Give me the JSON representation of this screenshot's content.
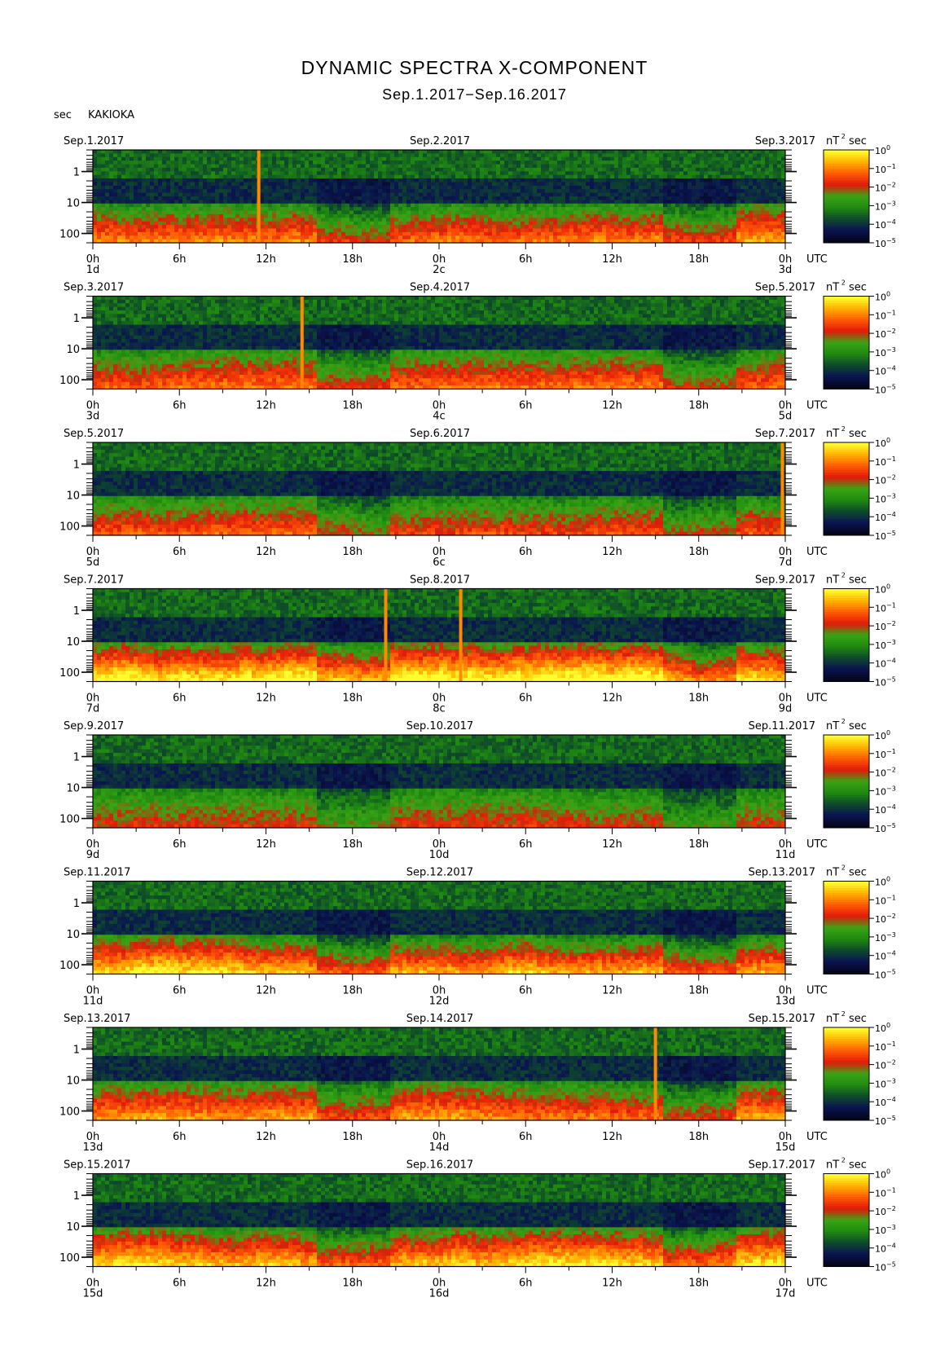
{
  "title": "DYNAMIC SPECTRA X-COMPONENT",
  "subtitle": "Sep.1.2017−Sep.16.2017",
  "unit_left": "sec",
  "station": "KAKIOKA",
  "colorbar_unit": "nT²sec",
  "colorbar_unit_parts": {
    "base": "nT",
    "exp": "2",
    "tail": "sec"
  },
  "colors": {
    "cmap": [
      "#05051a",
      "#0a1450",
      "#0e4a2a",
      "#1f8a10",
      "#3aa415",
      "#e01a0a",
      "#ff5a05",
      "#ffb000",
      "#ffff30"
    ]
  },
  "chart_data": {
    "type": "heatmap",
    "description_of_axes_shown": "period sec (log, reversed) vs UTC time",
    "y_axis": {
      "label": "sec",
      "scale": "log",
      "ticks": [
        "1",
        "10",
        "100"
      ],
      "tick_values": [
        1,
        10,
        100
      ],
      "range": [
        0.2,
        200
      ]
    },
    "x_axis": {
      "label": "UTC",
      "ticks": [
        "0h",
        "6h",
        "12h",
        "18h",
        "0h",
        "6h",
        "12h",
        "18h",
        "0h"
      ],
      "tick_hours": [
        0,
        6,
        12,
        18,
        24,
        30,
        36,
        42,
        48
      ]
    },
    "colorbar": {
      "scale": "log",
      "base": "10",
      "exponents": [
        "0",
        "−1",
        "−2",
        "−3",
        "−4",
        "−5"
      ],
      "values": [
        1,
        0.1,
        0.01,
        0.001,
        0.0001,
        1e-05
      ]
    },
    "panels": [
      {
        "date_left": "Sep.1.2017",
        "date_mid": "Sep.2.2017",
        "date_right": "Sep.3.2017",
        "day_labels": [
          "1d",
          "2c",
          "3d"
        ],
        "activity": 0.45,
        "spikes_hours": [
          11.5
        ]
      },
      {
        "date_left": "Sep.3.2017",
        "date_mid": "Sep.4.2017",
        "date_right": "Sep.5.2017",
        "day_labels": [
          "3d",
          "4c",
          "5d"
        ],
        "activity": 0.35,
        "spikes_hours": [
          14.5
        ]
      },
      {
        "date_left": "Sep.5.2017",
        "date_mid": "Sep.6.2017",
        "date_right": "Sep.7.2017",
        "day_labels": [
          "5d",
          "6c",
          "7d"
        ],
        "activity": 0.3,
        "spikes_hours": [
          47.8
        ]
      },
      {
        "date_left": "Sep.7.2017",
        "date_mid": "Sep.8.2017",
        "date_right": "Sep.9.2017",
        "day_labels": [
          "7d",
          "8c",
          "9d"
        ],
        "activity": 0.7,
        "spikes_hours": [
          20.3,
          25.5
        ]
      },
      {
        "date_left": "Sep.9.2017",
        "date_mid": "Sep.10.2017",
        "date_right": "Sep.11.2017",
        "day_labels": [
          "9d",
          "10d",
          "11d"
        ],
        "activity": 0.15,
        "spikes_hours": []
      },
      {
        "date_left": "Sep.11.2017",
        "date_mid": "Sep.12.2017",
        "date_right": "Sep.13.2017",
        "day_labels": [
          "11d",
          "12d",
          "13d"
        ],
        "activity": 0.65,
        "spikes_hours": []
      },
      {
        "date_left": "Sep.13.2017",
        "date_mid": "Sep.14.2017",
        "date_right": "Sep.15.2017",
        "day_labels": [
          "13d",
          "14d",
          "15d"
        ],
        "activity": 0.45,
        "spikes_hours": [
          39
        ]
      },
      {
        "date_left": "Sep.15.2017",
        "date_mid": "Sep.16.2017",
        "date_right": "Sep.17.2017",
        "day_labels": [
          "15d",
          "16d",
          "17d"
        ],
        "activity": 0.6,
        "spikes_hours": []
      }
    ]
  }
}
